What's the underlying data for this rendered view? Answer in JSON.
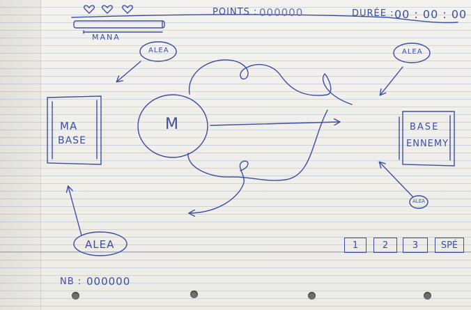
{
  "hud": {
    "hearts": [
      "heart-icon",
      "heart-icon",
      "heart-icon"
    ],
    "mana_label": "MANA",
    "points_label": "POINTS :",
    "points_value": "000000",
    "duration_label": "DURÉE :",
    "duration_value": "00 : 00 : 00"
  },
  "map": {
    "player_base": [
      "MA",
      "BASE"
    ],
    "enemy_base": [
      "BASE",
      "ENNEMY"
    ],
    "unit_label": "M",
    "alea_labels": [
      "ALEA",
      "ALEA",
      "ALEA",
      "ALEA"
    ]
  },
  "controls": {
    "buttons": [
      "1",
      "2",
      "3",
      "SPÉ"
    ]
  },
  "footer": {
    "nb_label": "NB :",
    "nb_value": "000000"
  },
  "colors": {
    "ink": "#3b4ea3",
    "paper": "#f3f2ee",
    "margin_line": "#dc465a"
  }
}
